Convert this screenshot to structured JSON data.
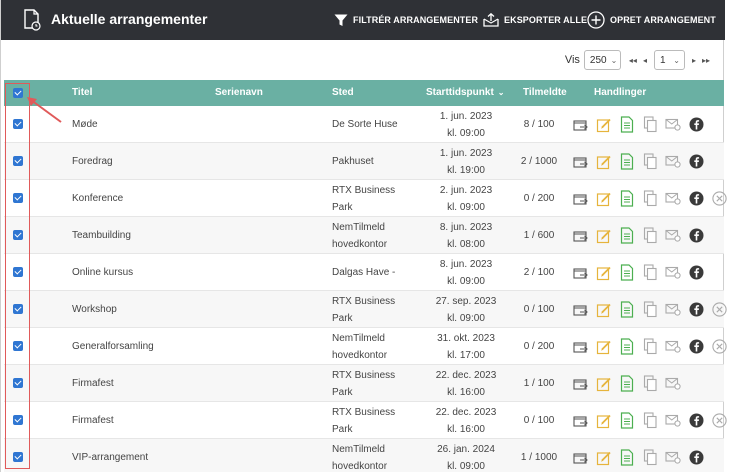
{
  "header": {
    "title": "Aktuelle arrangementer",
    "filter_label": "FILTRÉR ARRANGEMENTER",
    "export_label": "EKSPORTER ALLE",
    "create_label": "OPRET ARRANGEMENT"
  },
  "pager": {
    "show_label": "Vis",
    "page_size": "250",
    "first": "◂◂",
    "prev": "◂",
    "page": "1",
    "next": "▸",
    "last": "▸▸"
  },
  "columns": {
    "title": "Titel",
    "series": "Serienavn",
    "place": "Sted",
    "start": "Starttidspunkt",
    "registered": "Tilmeldte",
    "actions": "Handlinger"
  },
  "rows": [
    {
      "title": "Møde",
      "series": "",
      "place": [
        "De Sorte Huse"
      ],
      "date": "1. jun. 2023",
      "time": "kl. 09:00",
      "registered": "8 / 100",
      "facebook": true,
      "cancel": false
    },
    {
      "title": "Foredrag",
      "series": "",
      "place": [
        "Pakhuset"
      ],
      "date": "1. jun. 2023",
      "time": "kl. 19:00",
      "registered": "2 / 1000",
      "facebook": true,
      "cancel": false
    },
    {
      "title": "Konference",
      "series": "",
      "place": [
        "RTX Business",
        "Park"
      ],
      "date": "2. jun. 2023",
      "time": "kl. 09:00",
      "registered": "0 / 200",
      "facebook": true,
      "cancel": true
    },
    {
      "title": "Teambuilding",
      "series": "",
      "place": [
        "NemTilmeld",
        "hovedkontor"
      ],
      "date": "8. jun. 2023",
      "time": "kl. 08:00",
      "registered": "1 / 600",
      "facebook": true,
      "cancel": false
    },
    {
      "title": "Online kursus",
      "series": "",
      "place": [
        "Dalgas Have -"
      ],
      "date": "8. jun. 2023",
      "time": "kl. 09:00",
      "registered": "2 / 100",
      "facebook": true,
      "cancel": false
    },
    {
      "title": "Workshop",
      "series": "",
      "place": [
        "RTX Business",
        "Park"
      ],
      "date": "27. sep. 2023",
      "time": "kl. 09:00",
      "registered": "0 / 100",
      "facebook": true,
      "cancel": true
    },
    {
      "title": "Generalforsamling",
      "series": "",
      "place": [
        "NemTilmeld",
        "hovedkontor"
      ],
      "date": "31. okt. 2023",
      "time": "kl. 17:00",
      "registered": "0 / 200",
      "facebook": true,
      "cancel": true
    },
    {
      "title": "Firmafest",
      "series": "",
      "place": [
        "RTX Business",
        "Park"
      ],
      "date": "22. dec. 2023",
      "time": "kl. 16:00",
      "registered": "1 / 100",
      "facebook": false,
      "cancel": false
    },
    {
      "title": "Firmafest",
      "series": "",
      "place": [
        "RTX Business",
        "Park"
      ],
      "date": "22. dec. 2023",
      "time": "kl. 16:00",
      "registered": "0 / 100",
      "facebook": true,
      "cancel": true
    },
    {
      "title": "VIP-arrangement",
      "series": "",
      "place": [
        "NemTilmeld",
        "hovedkontor"
      ],
      "date": "26. jan. 2024",
      "time": "kl. 09:00",
      "registered": "1 / 1000",
      "facebook": true,
      "cancel": false
    }
  ],
  "colors": {
    "header_bg": "#2f3136",
    "table_head": "#6ab0a3",
    "checkbox": "#2f76d2",
    "annotation": "#e05a5a",
    "edit_icon": "#e6b43c",
    "doc_icon": "#4caf50",
    "facebook_icon": "#3a3a3a"
  },
  "icons": [
    "document-clock-icon",
    "filter-icon",
    "export-icon",
    "plus-circle-icon",
    "move-icon",
    "edit-icon",
    "document-icon",
    "copy-icon",
    "mail-icon",
    "facebook-icon",
    "cancel-icon"
  ]
}
